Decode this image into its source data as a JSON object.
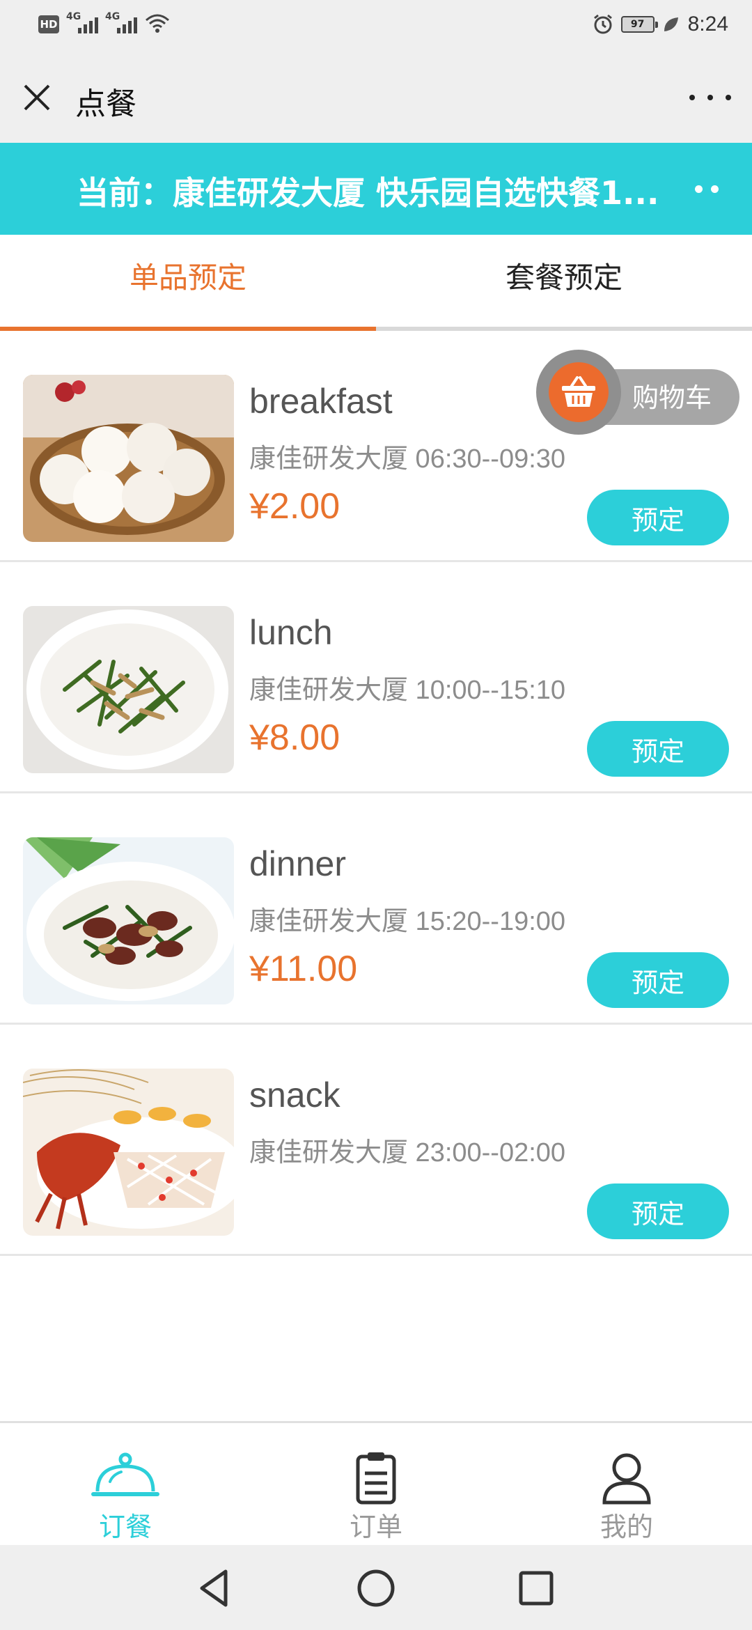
{
  "status_bar": {
    "hd_badge": "HD",
    "network_1": "4G",
    "network_2": "4G",
    "battery": "97",
    "time": "8:24"
  },
  "nav": {
    "title": "点餐",
    "close_icon": "close-icon",
    "more_icon": "more-dots-icon"
  },
  "banner": {
    "text": "当前：康佳研发大厦 快乐园自选快餐1..."
  },
  "tabs": [
    {
      "label": "单品预定",
      "active": true
    },
    {
      "label": "套餐预定",
      "active": false
    }
  ],
  "cart": {
    "label": "购物车",
    "icon": "basket-icon"
  },
  "items": [
    {
      "name": "breakfast",
      "meta": "康佳研发大厦 06:30--09:30",
      "price": "¥2.00",
      "button": "预定"
    },
    {
      "name": "lunch",
      "meta": "康佳研发大厦 10:00--15:10",
      "price": "¥8.00",
      "button": "预定"
    },
    {
      "name": "dinner",
      "meta": "康佳研发大厦 15:20--19:00",
      "price": "¥11.00",
      "button": "预定"
    },
    {
      "name": "snack",
      "meta": "康佳研发大厦 23:00--02:00",
      "price": "",
      "button": "预定"
    }
  ],
  "bottom_tabs": [
    {
      "label": "订餐",
      "icon": "cloche-icon",
      "active": true
    },
    {
      "label": "订单",
      "icon": "clipboard-icon",
      "active": false
    },
    {
      "label": "我的",
      "icon": "user-icon",
      "active": false
    }
  ],
  "colors": {
    "accent": "#2ccfd9",
    "orange": "#e8732e",
    "cart_orange": "#ec6b2d"
  }
}
